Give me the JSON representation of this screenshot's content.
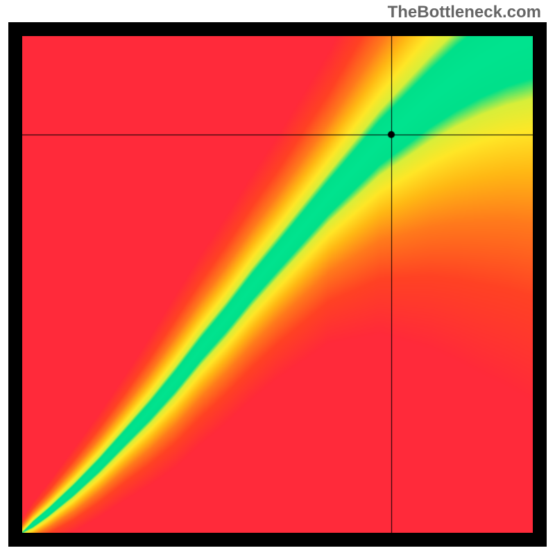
{
  "watermark": "TheBottleneck.com",
  "colors": {
    "frame": "#000000",
    "crosshair": "#000000",
    "marker": "#000000"
  },
  "chart_data": {
    "type": "heatmap",
    "title": "",
    "xlabel": "",
    "ylabel": "",
    "xlim": [
      0,
      1
    ],
    "ylim": [
      0,
      1
    ],
    "crosshair": {
      "x": 0.724,
      "y": 0.802
    },
    "marker": {
      "x": 0.724,
      "y": 0.802
    },
    "optimal_curve": {
      "description": "green ridge of optimal match; x is normalized horizontal position, y is normalized vertical position (0=bottom,1=top)",
      "points": [
        {
          "x": 0.0,
          "y": 0.0
        },
        {
          "x": 0.05,
          "y": 0.04
        },
        {
          "x": 0.1,
          "y": 0.085
        },
        {
          "x": 0.15,
          "y": 0.135
        },
        {
          "x": 0.2,
          "y": 0.19
        },
        {
          "x": 0.25,
          "y": 0.245
        },
        {
          "x": 0.3,
          "y": 0.305
        },
        {
          "x": 0.35,
          "y": 0.37
        },
        {
          "x": 0.4,
          "y": 0.43
        },
        {
          "x": 0.45,
          "y": 0.495
        },
        {
          "x": 0.5,
          "y": 0.555
        },
        {
          "x": 0.55,
          "y": 0.615
        },
        {
          "x": 0.6,
          "y": 0.675
        },
        {
          "x": 0.65,
          "y": 0.73
        },
        {
          "x": 0.7,
          "y": 0.785
        },
        {
          "x": 0.75,
          "y": 0.83
        },
        {
          "x": 0.8,
          "y": 0.875
        },
        {
          "x": 0.85,
          "y": 0.915
        },
        {
          "x": 0.9,
          "y": 0.95
        },
        {
          "x": 0.95,
          "y": 0.978
        },
        {
          "x": 1.0,
          "y": 1.0
        }
      ]
    },
    "band_width": {
      "description": "approximate vertical half-width of the green band at each x (normalized)",
      "points": [
        {
          "x": 0.0,
          "w": 0.005
        },
        {
          "x": 0.1,
          "w": 0.012
        },
        {
          "x": 0.2,
          "w": 0.018
        },
        {
          "x": 0.3,
          "w": 0.025
        },
        {
          "x": 0.4,
          "w": 0.03
        },
        {
          "x": 0.5,
          "w": 0.035
        },
        {
          "x": 0.6,
          "w": 0.042
        },
        {
          "x": 0.7,
          "w": 0.055
        },
        {
          "x": 0.8,
          "w": 0.072
        },
        {
          "x": 0.9,
          "w": 0.09
        },
        {
          "x": 1.0,
          "w": 0.105
        }
      ]
    },
    "color_scale": {
      "description": "distance-from-ridge (scaled by local sigma) to color",
      "stops": [
        {
          "d": 0.0,
          "color": "#00e48f"
        },
        {
          "d": 0.8,
          "color": "#00e08a"
        },
        {
          "d": 1.2,
          "color": "#d8ef3a"
        },
        {
          "d": 1.8,
          "color": "#ffe727"
        },
        {
          "d": 2.6,
          "color": "#ffb814"
        },
        {
          "d": 3.6,
          "color": "#ff7a1c"
        },
        {
          "d": 5.0,
          "color": "#ff4224"
        },
        {
          "d": 7.0,
          "color": "#ff2a3a"
        }
      ]
    }
  }
}
